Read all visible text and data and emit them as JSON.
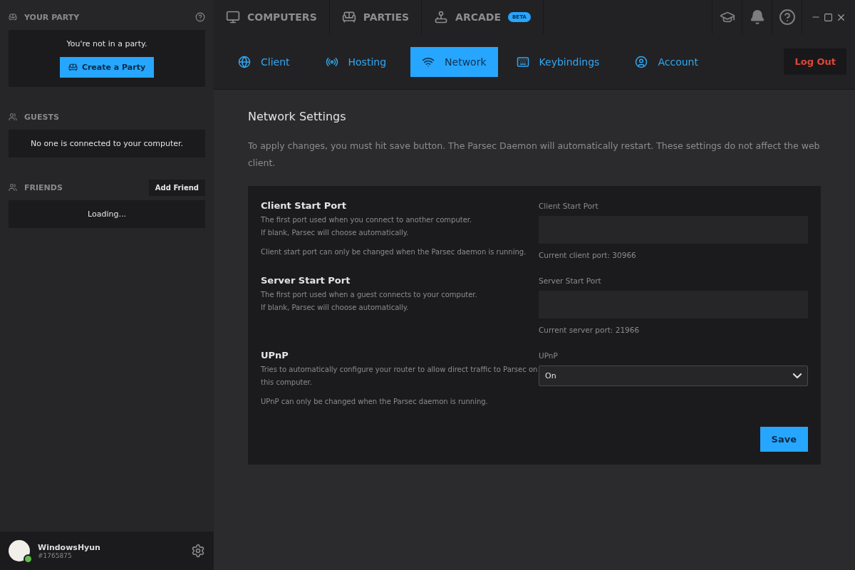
{
  "sidebar": {
    "party": {
      "title": "YOUR PARTY",
      "message": "You're not in a party.",
      "button": "Create a Party"
    },
    "guests": {
      "title": "GUESTS",
      "message": "No one is connected to your computer."
    },
    "friends": {
      "title": "FRIENDS",
      "button": "Add Friend",
      "message": "Loading..."
    },
    "user": {
      "name": "WindowsHyun",
      "tag": "#1765875",
      "online": true
    }
  },
  "top_nav": [
    {
      "label": "COMPUTERS"
    },
    {
      "label": "PARTIES"
    },
    {
      "label": "ARCADE",
      "badge": "BETA"
    }
  ],
  "tabs": [
    {
      "label": "Client",
      "selected": false
    },
    {
      "label": "Hosting",
      "selected": false
    },
    {
      "label": "Network",
      "selected": true
    },
    {
      "label": "Keybindings",
      "selected": false
    },
    {
      "label": "Account",
      "selected": false
    }
  ],
  "logout": "Log Out",
  "page": {
    "title": "Network Settings",
    "intro": "To apply changes, you must hit save button. The Parsec Daemon will automatically restart. These settings do not affect the web client.",
    "settings": [
      {
        "kind": "text",
        "title": "Client Start Port",
        "description": [
          "The first port used when you connect to another computer.",
          "If blank, Parsec will choose automatically."
        ],
        "note": "Client start port can only be changed when the Parsec daemon is running.",
        "field_label": "Client Start Port",
        "current": "Current client port: 30966"
      },
      {
        "kind": "text",
        "title": "Server Start Port",
        "description": [
          "The first port used when a guest connects to your computer.",
          "If blank, Parsec will choose automatically."
        ],
        "field_label": "Server Start Port",
        "current": "Current server port: 21966"
      },
      {
        "kind": "select",
        "title": "UPnP",
        "description": [
          "Tries to automatically configure your router to allow direct traffic to Parsec on this computer."
        ],
        "note": "UPnP can only be changed when the Parsec daemon is running.",
        "field_label": "UPnP",
        "value": "On"
      }
    ],
    "save": "Save"
  }
}
